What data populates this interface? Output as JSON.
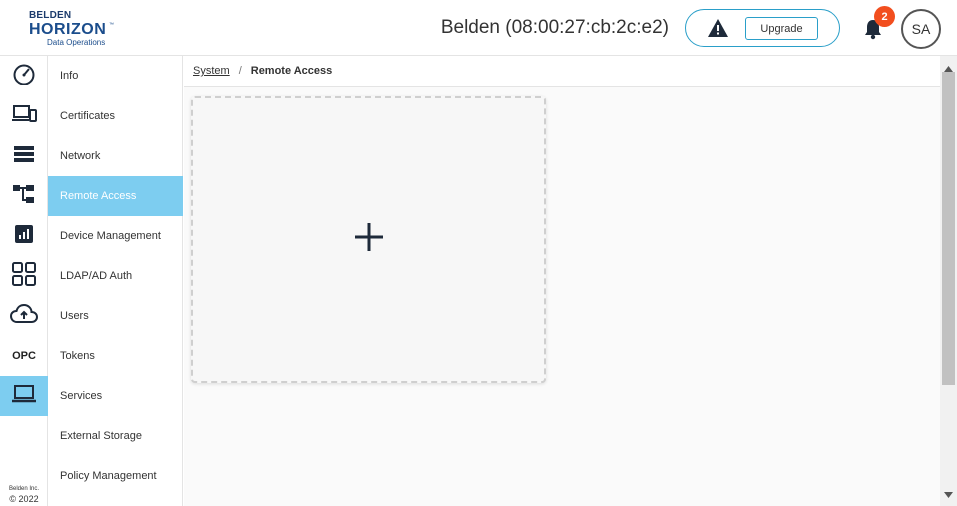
{
  "header": {
    "logo": {
      "brand_top": "BELDEN",
      "brand_main": "HORIZON",
      "trademark": "™",
      "tagline": "Data Operations"
    },
    "device_title": "Belden (08:00:27:cb:2c:e2)",
    "alert_icon": "warning-triangle-icon",
    "upgrade_label": "Upgrade",
    "notification_icon": "bell-icon",
    "notification_count": "2",
    "avatar_initials": "SA"
  },
  "rail": {
    "items": [
      {
        "icon": "dashboard-gauge-icon"
      },
      {
        "icon": "devices-icon"
      },
      {
        "icon": "list-icon"
      },
      {
        "icon": "hierarchy-icon"
      },
      {
        "icon": "bar-chart-icon"
      },
      {
        "icon": "apps-grid-icon"
      },
      {
        "icon": "cloud-upload-icon"
      },
      {
        "icon": "opc-icon",
        "label": "OPC"
      },
      {
        "icon": "laptop-icon",
        "active": true
      }
    ],
    "footer_company": "Belden Inc.",
    "footer_copyright": "© 2022"
  },
  "submenu": {
    "items": [
      {
        "label": "Info"
      },
      {
        "label": "Certificates"
      },
      {
        "label": "Network"
      },
      {
        "label": "Remote Access",
        "active": true
      },
      {
        "label": "Device Management"
      },
      {
        "label": "LDAP/AD Auth"
      },
      {
        "label": "Users"
      },
      {
        "label": "Tokens"
      },
      {
        "label": "Services"
      },
      {
        "label": "External Storage"
      },
      {
        "label": "Policy Management"
      }
    ]
  },
  "breadcrumb": {
    "parent": "System",
    "separator": "/",
    "current": "Remote Access"
  },
  "main": {
    "add_icon": "plus-icon"
  },
  "colors": {
    "accent": "#7dcdf0",
    "brand": "#1b4d8c",
    "badge": "#f24e1e",
    "pill_border": "#2a9fc9"
  }
}
